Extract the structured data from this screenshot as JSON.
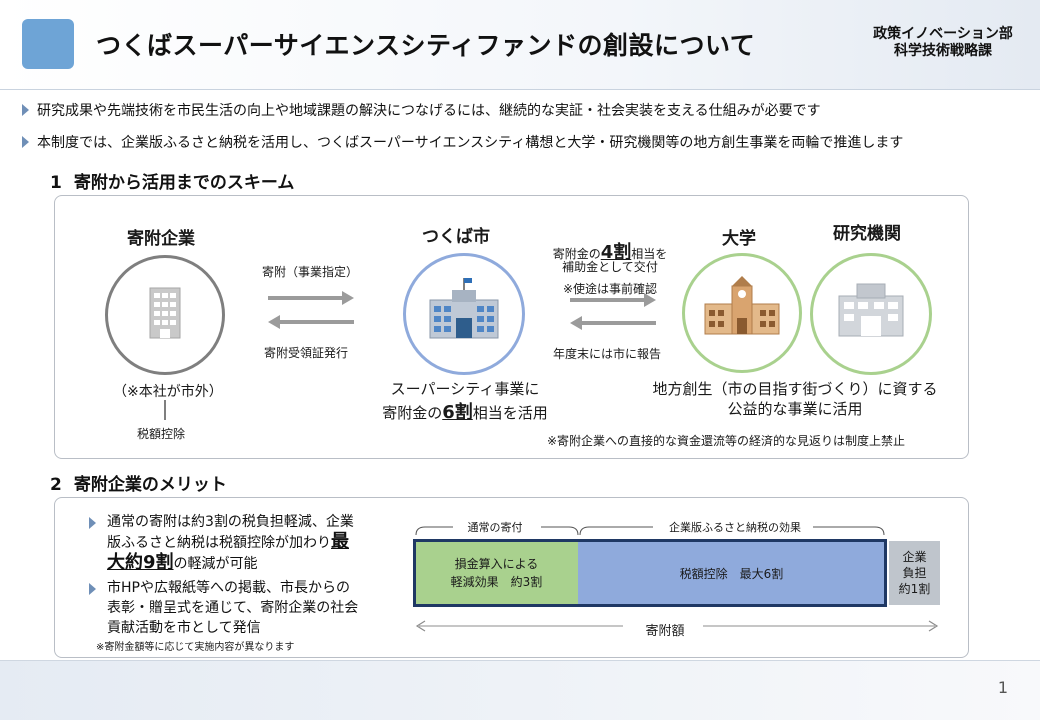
{
  "header": {
    "title": "つくばスーパーサイエンスシティファンドの創設について",
    "dept_line1": "政策イノベーション部",
    "dept_line2": "科学技術戦略課"
  },
  "intro": [
    "研究成果や先端技術を市民生活の向上や地域課題の解決につなげるには、継続的な実証・社会実装を支える仕組みが必要です",
    "本制度では、企業版ふるさと納税を活用し、つくばスーパーサイエンスシティ構想と大学・研究機関等の地方創生事業を両輪で推進します"
  ],
  "section1": {
    "num": "1",
    "title": "寄附から活用までのスキーム",
    "company": {
      "label": "寄附企業",
      "note": "（※本社が市外）",
      "tax": "税額控除"
    },
    "flow_left": {
      "top": "寄附（事業指定）",
      "bottom": "寄附受領証発行"
    },
    "city": {
      "label": "つくば市",
      "desc1": "スーパーシティ事業に",
      "desc2_pre": "寄附金の",
      "desc2_em": "6割",
      "desc2_post": "相当を活用"
    },
    "flow_right": {
      "line1_pre": "寄附金の",
      "line1_em": "4割",
      "line1_post": "相当を",
      "line2": "補助金として交付",
      "line3": "※使途は事前確認",
      "bottom": "年度末には市に報告"
    },
    "university": {
      "label": "大学"
    },
    "research": {
      "label": "研究機関"
    },
    "right_desc1": "地方創生（市の目指す街づくり）に資する",
    "right_desc2": "公益的な事業に活用",
    "disclaimer": "※寄附企業への直接的な資金還流等の経済的な見返りは制度上禁止"
  },
  "section2": {
    "num": "2",
    "title": "寄附企業のメリット",
    "bullet1_a": "通常の寄附は約3割の税負担軽減、企業",
    "bullet1_b_pre": "版ふるさと納税は税額控除が加わり",
    "bullet1_b_em": "最",
    "bullet1_c_em": "大約9割",
    "bullet1_c_post": "の軽減が可能",
    "bullet2_a": "市HPや広報紙等への掲載、市長からの",
    "bullet2_b": "表彰・贈呈式を通じて、寄附企業の社会",
    "bullet2_c": "貢献活動を市として発信",
    "note": "※寄附金額等に応じて実施内容が異なります",
    "brace_left": "通常の寄付",
    "brace_right": "企業版ふるさと納税の効果",
    "green_line1": "損金算入による",
    "green_line2": "軽減効果　約3割",
    "blue_label": "税額控除　最大6割",
    "gray_line1": "企業",
    "gray_line2": "負担",
    "gray_line3": "約1割",
    "axis_label": "寄附額"
  },
  "colors": {
    "accent_blue": "#6ea4d6",
    "city_circle": "#8faadc",
    "univ_circle": "#a9d18e",
    "company_circle": "#7f7f7f",
    "bar_green": "#a9d18e",
    "bar_blue": "#8faadc",
    "bar_gray": "#bfc5cc",
    "bar_frame": "#1f3864"
  },
  "footer": {
    "page": "1"
  }
}
